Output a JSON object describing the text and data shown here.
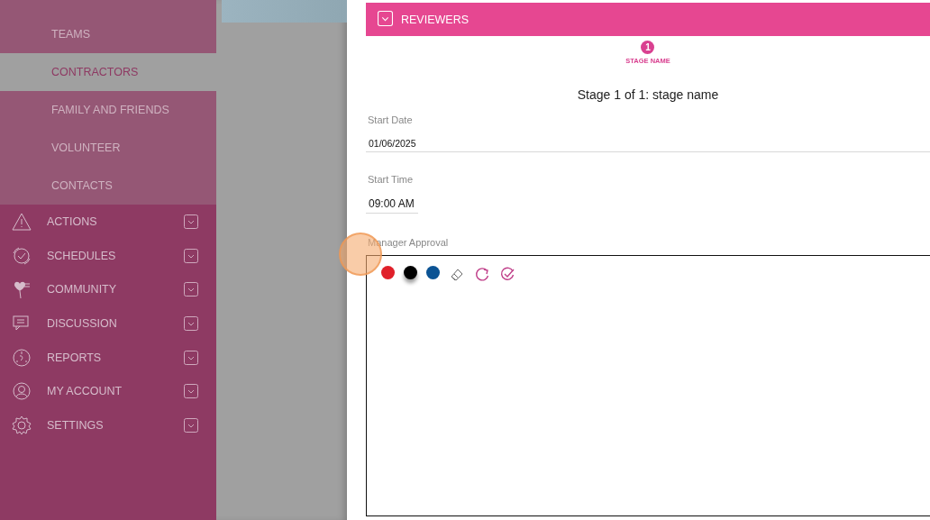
{
  "sidebar": {
    "sub_items": [
      {
        "label": "TEAMS",
        "selected": false
      },
      {
        "label": "CONTRACTORS",
        "selected": true
      },
      {
        "label": "FAMILY AND FRIENDS",
        "selected": false
      },
      {
        "label": "VOLUNTEER",
        "selected": false
      },
      {
        "label": "CONTACTS",
        "selected": false
      }
    ],
    "menu": [
      {
        "label": "ACTIONS"
      },
      {
        "label": "SCHEDULES"
      },
      {
        "label": "COMMUNITY"
      },
      {
        "label": "DISCUSSION"
      },
      {
        "label": "REPORTS"
      },
      {
        "label": "MY ACCOUNT"
      },
      {
        "label": "SETTINGS"
      }
    ]
  },
  "section": {
    "title": "REVIEWERS"
  },
  "stepper": {
    "steps": [
      {
        "number": "1",
        "label": "STAGE NAME",
        "selected": true
      }
    ]
  },
  "stage_title": "Stage 1 of 1: stage name",
  "fields": [
    {
      "label": "Start Date",
      "value": "01/06/2025",
      "kind": "date"
    },
    {
      "label": "Start Time",
      "value": "09:00 AM",
      "kind": "time"
    }
  ],
  "signature": {
    "label": "Manager Approval",
    "pens": [
      {
        "color": "#e0202a",
        "selected": false
      },
      {
        "color": "#000000",
        "selected": true
      },
      {
        "color": "#0b5394",
        "selected": false
      }
    ],
    "tools": [
      {
        "kind": "eraser"
      },
      {
        "kind": "redo"
      },
      {
        "kind": "confirm"
      }
    ]
  }
}
